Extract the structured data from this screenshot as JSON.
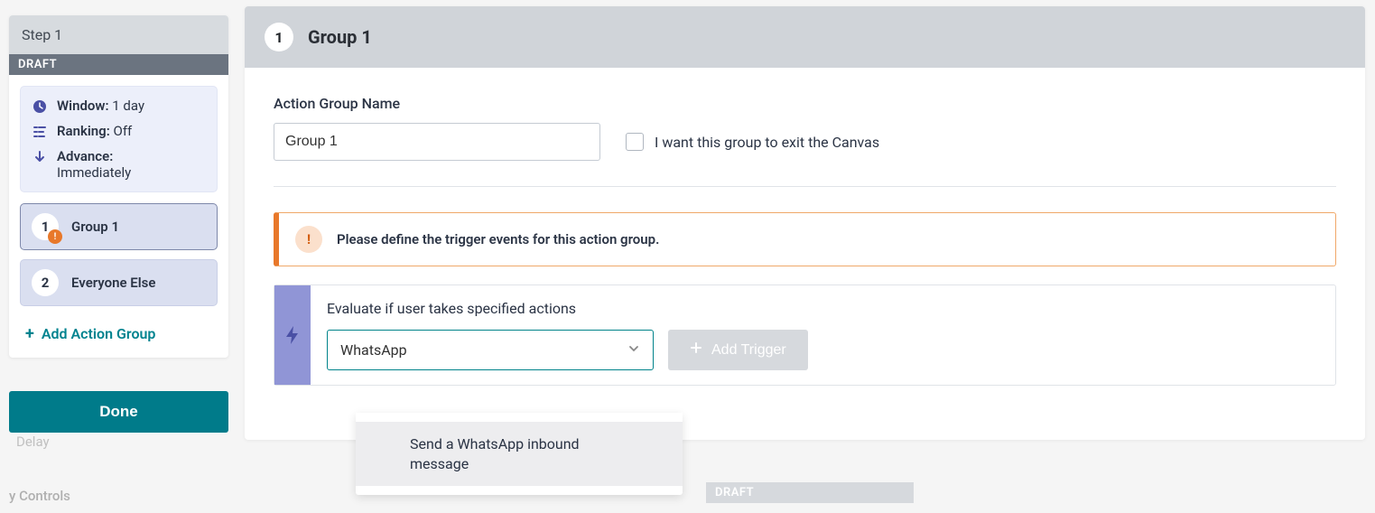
{
  "sidebar": {
    "step_title": "Step 1",
    "draft_label": "DRAFT",
    "info": {
      "window_label": "Window:",
      "window_value": "1 day",
      "ranking_label": "Ranking:",
      "ranking_value": "Off",
      "advance_label": "Advance:",
      "advance_value": "Immediately"
    },
    "groups": [
      {
        "num": "1",
        "label": "Group 1",
        "alert": true
      },
      {
        "num": "2",
        "label": "Everyone Else",
        "alert": false
      }
    ],
    "add_group": "Add Action Group",
    "done": "Done"
  },
  "background": {
    "delay": "Delay",
    "controls": "y Controls"
  },
  "main": {
    "header_num": "1",
    "header_title": "Group 1",
    "form_label": "Action Group Name",
    "name_value": "Group 1",
    "checkbox_label": "I want this group to exit the Canvas",
    "warning": "Please define the trigger events for this action group.",
    "trigger_label": "Evaluate if user takes specified actions",
    "select_value": "WhatsApp",
    "add_trigger": "Add Trigger"
  },
  "dropdown": {
    "item": "Send a WhatsApp inbound message"
  },
  "bottom": {
    "draft": "DRAFT"
  }
}
